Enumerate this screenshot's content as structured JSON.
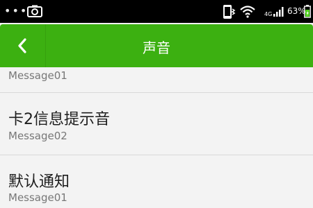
{
  "status_bar": {
    "overflow_dots": "•••",
    "network_type": "4G",
    "battery_percent": "63%",
    "icons": [
      "camera-icon",
      "vibrate-icon",
      "wifi-icon",
      "signal-icon",
      "battery-icon"
    ]
  },
  "header": {
    "title": "声音",
    "back_icon": "back-arrow-icon",
    "background_color": "#3cb011"
  },
  "list": {
    "items": [
      {
        "title": "",
        "subtitle": "Message01"
      },
      {
        "title": "卡2信息提示音",
        "subtitle": "Message02"
      },
      {
        "title": "默认通知",
        "subtitle": "Message01"
      }
    ]
  }
}
